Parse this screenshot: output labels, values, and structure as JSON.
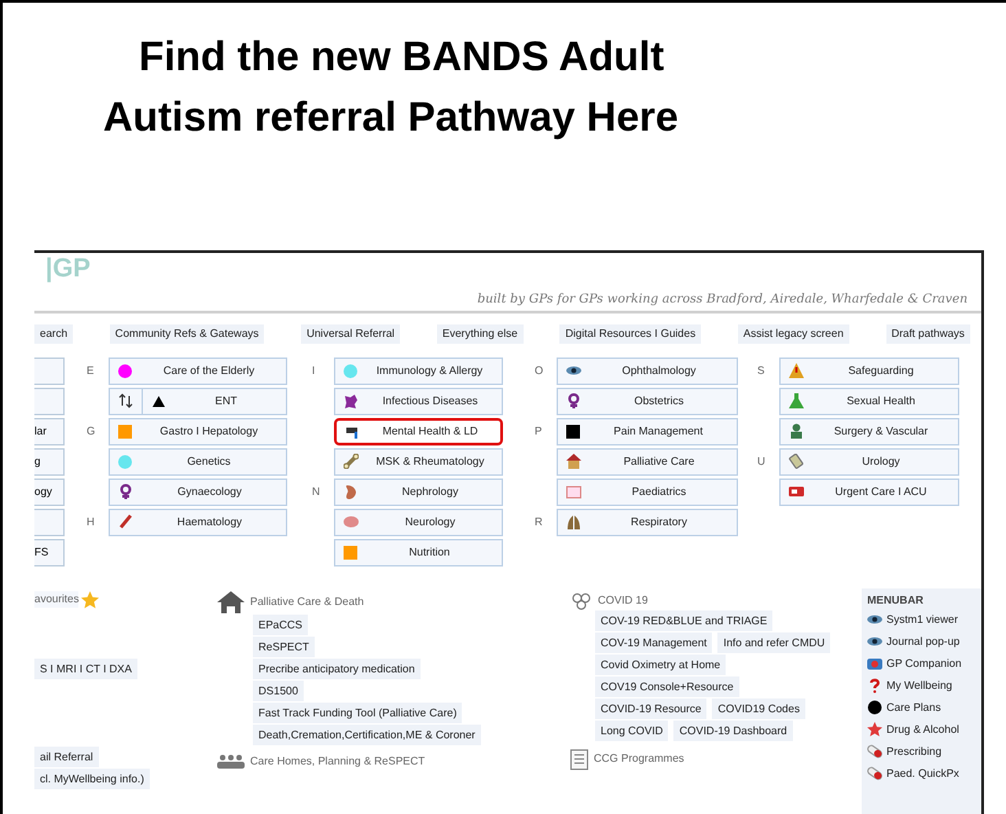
{
  "slide": {
    "title_lines": [
      "Find the new BANDS Adult",
      "Autism referral Pathway Here"
    ]
  },
  "site": {
    "logo": "|GP",
    "tagline": "built by GPs for GPs working across Bradford, Airedale, Wharfedale & Craven",
    "nav": [
      "earch",
      "Community Refs & Gateways",
      "Universal Referral",
      "Everything else",
      "Digital Resources I Guides",
      "Assist legacy screen",
      "Draft pathways"
    ],
    "left_fragments": [
      {
        "kind": "blank"
      },
      {
        "kind": "blank"
      },
      {
        "kind": "text",
        "text": "lar"
      },
      {
        "kind": "text",
        "text": "g"
      },
      {
        "kind": "text",
        "text": "ogy"
      },
      {
        "kind": "blank"
      },
      {
        "kind": "text",
        "text": "FS"
      }
    ],
    "specialty_columns": [
      {
        "rows": [
          {
            "letter": "E",
            "label": "Care of the Elderly",
            "color": "#ff00ff",
            "highlighted": false
          },
          {
            "label": "ENT",
            "highlighted": false
          },
          {
            "letter": "G",
            "label": "Gastro I Hepatology",
            "color": "#ff9900",
            "highlighted": false
          },
          {
            "label": "Genetics",
            "color": "#66e6ee",
            "highlighted": false
          },
          {
            "label": "Gynaecology",
            "highlighted": false
          },
          {
            "letter": "H",
            "label": "Haematology",
            "highlighted": false
          }
        ]
      },
      {
        "rows": [
          {
            "letter": "I",
            "label": "Immunology & Allergy",
            "color": "#66e6ee",
            "highlighted": false
          },
          {
            "label": "Infectious Diseases",
            "highlighted": false
          },
          {
            "label": "Mental Health & LD",
            "highlighted": true
          },
          {
            "label": "MSK & Rheumatology",
            "highlighted": false
          },
          {
            "letter": "N",
            "label": "Nephrology",
            "highlighted": false
          },
          {
            "label": "Neurology",
            "highlighted": false
          },
          {
            "label": "Nutrition",
            "color": "#ff9900",
            "highlighted": false
          }
        ]
      },
      {
        "rows": [
          {
            "letter": "O",
            "label": "Ophthalmology",
            "highlighted": false
          },
          {
            "label": "Obstetrics",
            "highlighted": false
          },
          {
            "letter": "P",
            "label": "Pain Management",
            "color": "#000000",
            "highlighted": false
          },
          {
            "label": "Palliative Care",
            "highlighted": false
          },
          {
            "label": "Paediatrics",
            "highlighted": false
          },
          {
            "letter": "R",
            "label": "Respiratory",
            "highlighted": false
          }
        ]
      },
      {
        "rows": [
          {
            "letter": "S",
            "label": "Safeguarding",
            "highlighted": false
          },
          {
            "label": "Sexual Health",
            "highlighted": false
          },
          {
            "label": "Surgery & Vascular",
            "highlighted": false
          },
          {
            "letter": "U",
            "label": "Urology",
            "highlighted": false
          },
          {
            "label": "Urgent Care I ACU",
            "highlighted": false
          }
        ]
      }
    ],
    "favourites": {
      "title": "avourites",
      "items": [
        "S I MRI I CT I DXA",
        "ail Referral",
        "cl. MyWellbeing info.)"
      ]
    },
    "palliative": {
      "title": "Palliative Care & Death",
      "links": [
        "EPaCCS",
        "ReSPECT",
        "Precribe anticipatory medication",
        "DS1500",
        "Fast Track Funding Tool (Palliative Care)",
        "Death,Cremation,Certification,ME & Coroner"
      ]
    },
    "care_homes": {
      "title": "Care Homes, Planning & ReSPECT"
    },
    "covid": {
      "title": "COVID 19",
      "link_rows": [
        [
          "COV-19  RED&BLUE and TRIAGE"
        ],
        [
          "COV-19 Management",
          "Info and refer CMDU"
        ],
        [
          "Covid Oximetry at Home"
        ],
        [
          "COV19 Console+Resource"
        ],
        [
          "COVID-19 Resource",
          "COVID19 Codes"
        ],
        [
          "Long COVID",
          "COVID-19 Dashboard"
        ]
      ]
    },
    "ccg": {
      "title": "CCG Programmes"
    },
    "menubar": {
      "title": "MENUBAR",
      "items": [
        {
          "label": "Systm1 viewer"
        },
        {
          "label": "Journal pop-up"
        },
        {
          "label": "GP Companion"
        },
        {
          "label": "My Wellbeing"
        },
        {
          "label": "Care Plans"
        },
        {
          "label": "Drug & Alcohol"
        },
        {
          "label": "Prescribing"
        },
        {
          "label": "Paed. QuickPx"
        }
      ]
    }
  }
}
